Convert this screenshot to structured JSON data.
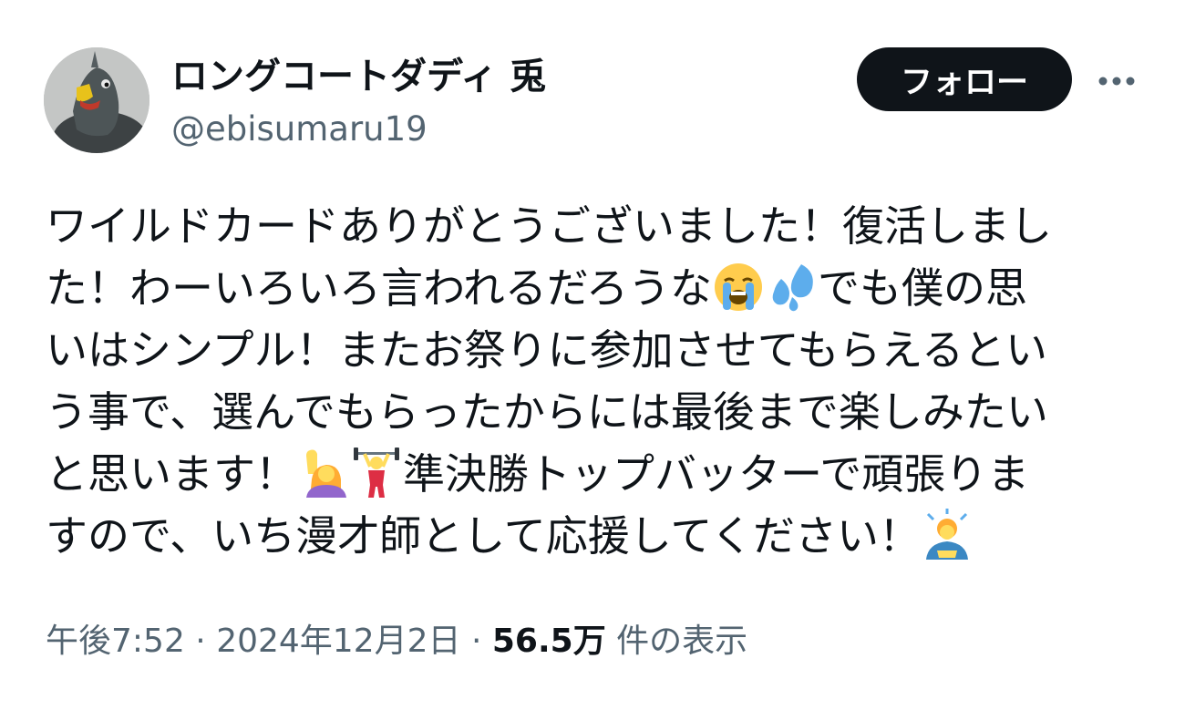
{
  "author": {
    "display_name": "ロングコートダディ 兎",
    "handle": "@ebisumaru19"
  },
  "actions": {
    "follow_label": "フォロー",
    "more_icon": "more-dots-icon"
  },
  "body": {
    "lines": [
      "ワイルドカードありがとうございました！復活しまし",
      "た！わーいろいろ言われるだろうな",
      "でも僕の思",
      "いはシンプル！またお祭りに参加させてもらえるとい",
      "う事で、選んでもらったからには最後まで楽しみたい",
      "と思います！",
      "準決勝トップバッターで頑張りま",
      "すので、いち漫才師として応援してください！"
    ],
    "emojis": [
      "loudly-crying-face",
      "sweat-droplets",
      "woman-raising-hand",
      "woman-lifting-weights",
      "person-bowing"
    ]
  },
  "meta": {
    "time": "午後7:52",
    "separator": " · ",
    "date": "2024年12月2日",
    "views_count": "56.5万",
    "views_label": " 件の表示"
  },
  "colors": {
    "text_primary": "#0f1419",
    "text_secondary": "#536471",
    "button_bg": "#0f1419",
    "button_text": "#ffffff"
  }
}
